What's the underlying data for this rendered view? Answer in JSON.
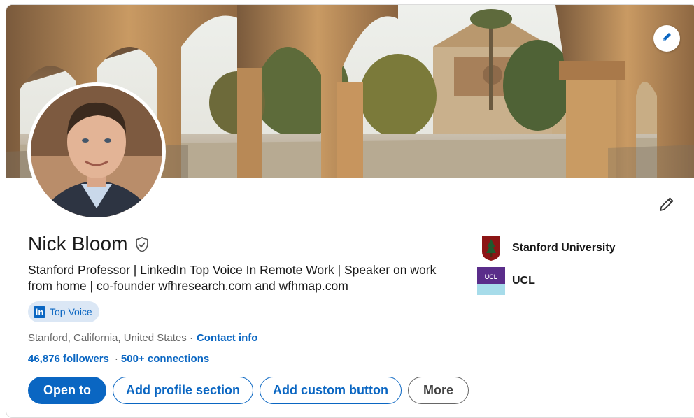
{
  "profile": {
    "name": "Nick Bloom",
    "headline": "Stanford Professor | LinkedIn Top Voice In Remote Work | Speaker on work from home | co-founder wfhresearch.com and wfhmap.com",
    "badge": {
      "logo": "in",
      "label": "Top Voice"
    },
    "location": "Stanford, California, United States ·",
    "contact_label": "Contact info",
    "followers": "46,876 followers",
    "separator": "·",
    "connections": "500+ connections"
  },
  "education": [
    {
      "name": "Stanford University",
      "icon": "stanford-logo"
    },
    {
      "name": "UCL",
      "icon": "ucl-logo",
      "logo_text": "UCL"
    }
  ],
  "actions": {
    "open_to": "Open to",
    "add_profile_section": "Add profile section",
    "add_custom_button": "Add custom button",
    "more": "More"
  },
  "colors": {
    "brand_blue": "#0a66c2",
    "badge_bg": "#dbe7f5",
    "stanford_red": "#8c1515",
    "ucl_purple": "#5a2d8a",
    "ucl_light": "#a7dcea"
  }
}
